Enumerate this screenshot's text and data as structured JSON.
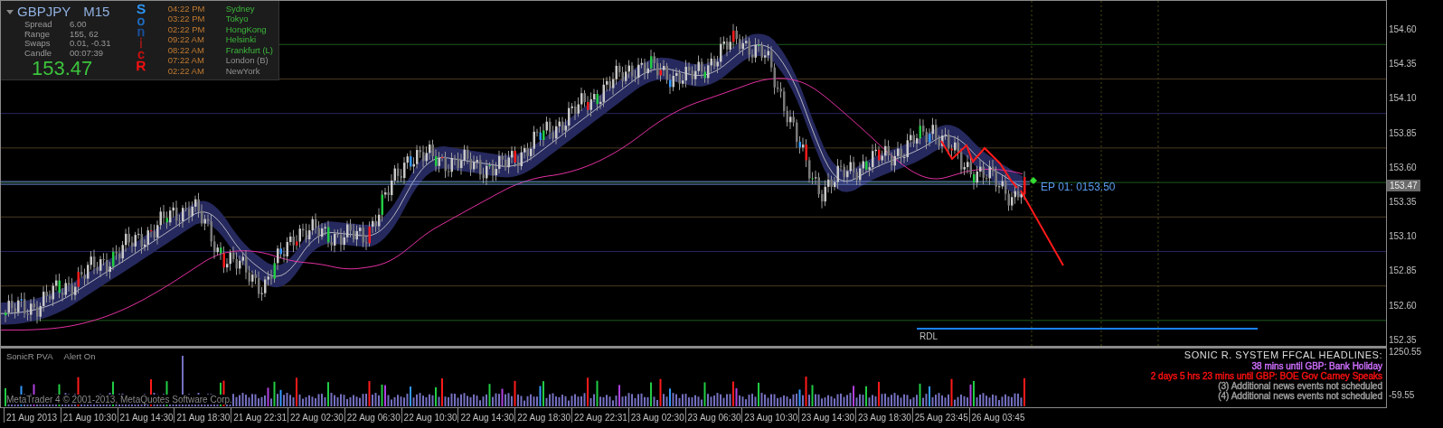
{
  "info_panel": {
    "symbol": "GBPJPY",
    "timeframe": "M15",
    "rows": [
      {
        "label": "Spread",
        "value": "6.00"
      },
      {
        "label": "Range",
        "value": "155, 62"
      },
      {
        "label": "Swaps",
        "value": "0.01, -0.31"
      },
      {
        "label": "Candle",
        "value": "00:07:39"
      }
    ],
    "price": "153.47",
    "sonic_letters": [
      {
        "text": "S",
        "color": "#2f9bff"
      },
      {
        "text": "o",
        "color": "#1f70c8"
      },
      {
        "text": "n",
        "color": "#1a4f9a"
      },
      {
        "text": "i",
        "color": "#a01818"
      },
      {
        "text": "c",
        "color": "#d01010"
      },
      {
        "text": "R",
        "color": "#ff1010"
      }
    ],
    "sessions": [
      {
        "time": "04:22 PM",
        "city": "Sydney",
        "active": true
      },
      {
        "time": "03:22 PM",
        "city": "Tokyo",
        "active": true
      },
      {
        "time": "02:22 PM",
        "city": "HongKong",
        "active": true
      },
      {
        "time": "09:22 AM",
        "city": "Helsinki",
        "active": true
      },
      {
        "time": "08:22 AM",
        "city": "Frankfurt  (L)",
        "active": true
      },
      {
        "time": "07:22 AM",
        "city": "London  (B)",
        "active": false
      },
      {
        "time": "02:22 AM",
        "city": "NewYork",
        "active": false
      }
    ]
  },
  "price_axis": [
    "154.60",
    "154.35",
    "154.10",
    "153.85",
    "153.60",
    "153.35",
    "153.10",
    "152.85",
    "152.60",
    "152.35"
  ],
  "current_price": "153.47",
  "entry_label": "EP 01:  0153.50",
  "rdl_label": "RDL",
  "indicator": {
    "name": "SonicR PVA",
    "alert": "Alert On"
  },
  "headlines": {
    "title": "SONIC R. SYSTEM  FFCAL HEADLINES:",
    "items": [
      {
        "text": "38 mins until GBP: Bank Holiday",
        "color": "#d070ff"
      },
      {
        "text": "2 days 5 hrs 23 mins until GBP: BOE Gov Carney Speaks",
        "color": "#ff1010"
      },
      {
        "text": "(3)  Additional news events not scheduled",
        "color": "#a0a0a0"
      },
      {
        "text": "(4)  Additional news events not scheduled",
        "color": "#a0a0a0"
      }
    ]
  },
  "sub_axis": [
    "1250.55",
    "-59.55"
  ],
  "copyright": "MetaTrader 4 © 2001-2013, MetaQuotes Software Corp.",
  "time_axis": [
    "21 Aug 2013",
    "21 Aug 10:30",
    "21 Aug 14:30",
    "21 Aug 18:30",
    "21 Aug 22:31",
    "22 Aug 02:30",
    "22 Aug 06:30",
    "22 Aug 10:30",
    "22 Aug 14:30",
    "22 Aug 18:30",
    "22 Aug 22:31",
    "23 Aug 02:30",
    "23 Aug 06:30",
    "23 Aug 10:30",
    "23 Aug 14:30",
    "23 Aug 18:30",
    "25 Aug 23:45",
    "26 Aug 03:45"
  ]
}
